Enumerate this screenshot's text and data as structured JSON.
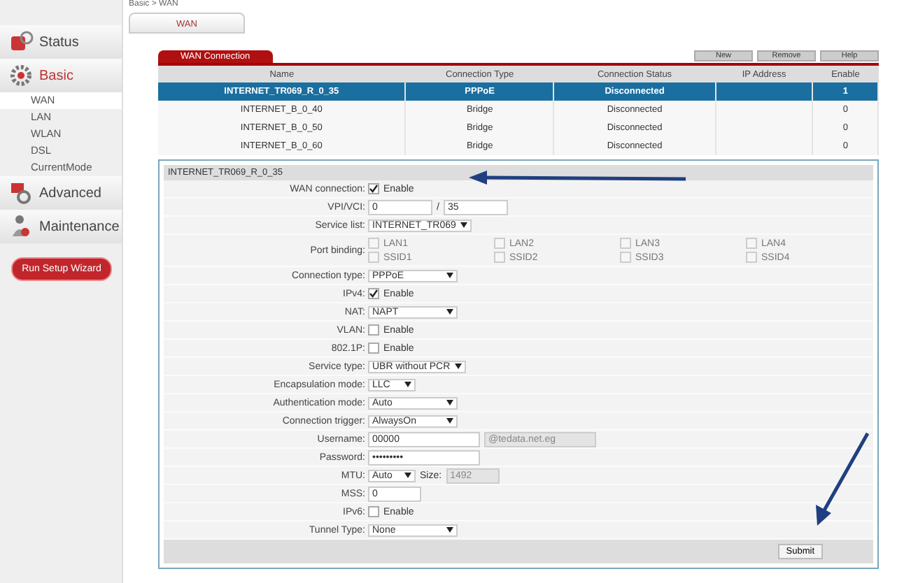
{
  "breadcrumb": "Basic > WAN",
  "page_tabs": [
    {
      "label": "WAN",
      "selected": true
    }
  ],
  "sidebar": {
    "sections": [
      {
        "kind": "status",
        "label": "Status",
        "selected": false
      },
      {
        "kind": "basic",
        "label": "Basic",
        "selected": true,
        "children": [
          {
            "label": "WAN",
            "selected": true
          },
          {
            "label": "LAN",
            "selected": false
          },
          {
            "label": "WLAN",
            "selected": false
          },
          {
            "label": "DSL",
            "selected": false
          },
          {
            "label": "CurrentMode",
            "selected": false
          }
        ]
      },
      {
        "kind": "advanced",
        "label": "Advanced",
        "selected": false
      },
      {
        "kind": "maintenance",
        "label": "Maintenance",
        "selected": false
      }
    ],
    "wizard_button": "Run Setup Wizard"
  },
  "connections": {
    "title": "WAN Connection",
    "buttons": [
      "New",
      "Remove",
      "Help"
    ],
    "columns": [
      "Name",
      "Connection Type",
      "Connection Status",
      "IP Address",
      "Enable"
    ],
    "rows": [
      {
        "cells": [
          "INTERNET_TR069_R_0_35",
          "PPPoE",
          "Disconnected",
          "",
          "1"
        ],
        "selected": true
      },
      {
        "cells": [
          "INTERNET_B_0_40",
          "Bridge",
          "Disconnected",
          "",
          "0"
        ],
        "selected": false
      },
      {
        "cells": [
          "INTERNET_B_0_50",
          "Bridge",
          "Disconnected",
          "",
          "0"
        ],
        "selected": false
      },
      {
        "cells": [
          "INTERNET_B_0_60",
          "Bridge",
          "Disconnected",
          "",
          "0"
        ],
        "selected": false
      }
    ]
  },
  "form": {
    "title": "INTERNET_TR069_R_0_35",
    "fields": [
      {
        "kind": "checkbox",
        "label": "WAN connection:",
        "option": "Enable",
        "checked": true
      },
      {
        "kind": "pair",
        "label": "VPI/VCI:",
        "value": "0",
        "separator": "/",
        "value2": "35"
      },
      {
        "kind": "select",
        "label": "Service list:",
        "value": "INTERNET_TR069"
      },
      {
        "kind": "ports",
        "label": "Port binding:",
        "options": [
          {
            "label": "LAN1",
            "checked": false
          },
          {
            "label": "LAN2",
            "checked": false
          },
          {
            "label": "LAN3",
            "checked": false
          },
          {
            "label": "LAN4",
            "checked": false
          },
          {
            "label": "SSID1",
            "checked": false
          },
          {
            "label": "SSID2",
            "checked": false
          },
          {
            "label": "SSID3",
            "checked": false
          },
          {
            "label": "SSID4",
            "checked": false
          }
        ]
      },
      {
        "kind": "select",
        "label": "Connection type:",
        "value": "PPPoE"
      },
      {
        "kind": "checkbox",
        "label": "IPv4:",
        "option": "Enable",
        "checked": true
      },
      {
        "kind": "select",
        "label": "NAT:",
        "value": "NAPT"
      },
      {
        "kind": "checkbox",
        "label": "VLAN:",
        "option": "Enable",
        "checked": false
      },
      {
        "kind": "checkbox",
        "label": "802.1P:",
        "option": "Enable",
        "checked": false
      },
      {
        "kind": "select",
        "label": "Service type:",
        "value": "UBR without PCR"
      },
      {
        "kind": "select",
        "label": "Encapsulation mode:",
        "value": "LLC"
      },
      {
        "kind": "select",
        "label": "Authentication mode:",
        "value": "Auto"
      },
      {
        "kind": "select",
        "label": "Connection trigger:",
        "value": "AlwaysOn"
      },
      {
        "kind": "text",
        "label": "Username:",
        "value": "00000",
        "suffix": "@tedata.net.eg"
      },
      {
        "kind": "text",
        "label": "Password:",
        "value": "•••••••••"
      },
      {
        "kind": "mtu",
        "label": "MTU:",
        "value": "Auto",
        "size_label": "Size:",
        "size": "1492"
      },
      {
        "kind": "text",
        "label": "MSS:",
        "value": "0"
      },
      {
        "kind": "checkbox",
        "label": "IPv6:",
        "option": "Enable",
        "checked": false
      },
      {
        "kind": "select",
        "label": "Tunnel Type:",
        "value": "None"
      }
    ],
    "submit": "Submit"
  }
}
